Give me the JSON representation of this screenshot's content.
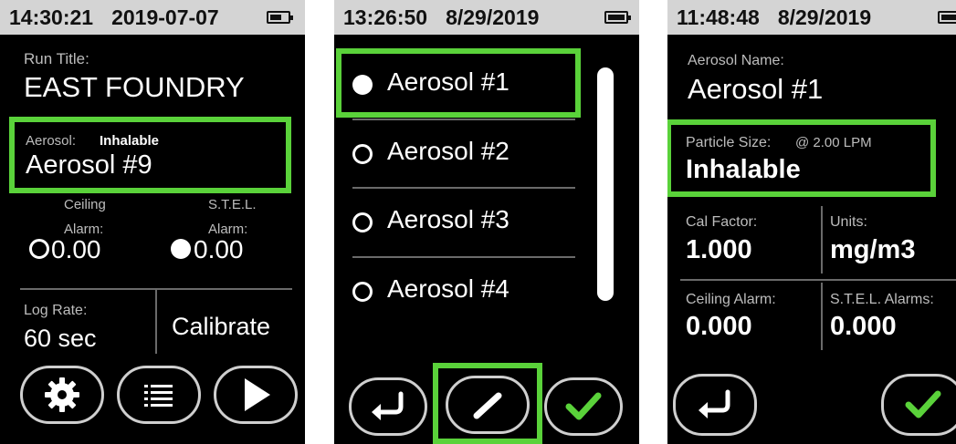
{
  "colors": {
    "highlight": "#5ad23a",
    "screen_bg": "#000000",
    "status_bg": "#d4d4d4",
    "check": "#5ad23a"
  },
  "screen1": {
    "status": {
      "time": "14:30:21",
      "date": "2019-07-07"
    },
    "run_title_label": "Run Title:",
    "run_title_value": "EAST FOUNDRY",
    "aerosol_label": "Aerosol:",
    "aerosol_type": "Inhalable",
    "aerosol_value": "Aerosol #9",
    "ceiling_label": "Ceiling",
    "ceiling_alarm_label": "Alarm:",
    "ceiling_alarm_value": "0.00",
    "stel_label": "S.T.E.L.",
    "stel_alarm_label": "Alarm:",
    "stel_alarm_value": "0.00",
    "log_rate_label": "Log Rate:",
    "log_rate_value": "60 sec",
    "calibrate_label": "Calibrate",
    "icons": [
      "gear-icon",
      "list-icon",
      "play-icon"
    ]
  },
  "screen2": {
    "status": {
      "time": "13:26:50",
      "date": "8/29/2019"
    },
    "items": [
      {
        "label": "Aerosol #1",
        "selected": true
      },
      {
        "label": "Aerosol #2",
        "selected": false
      },
      {
        "label": "Aerosol #3",
        "selected": false
      },
      {
        "label": "Aerosol #4",
        "selected": false
      }
    ],
    "icons": [
      "back-icon",
      "edit-pen-icon",
      "check-icon"
    ]
  },
  "screen3": {
    "status": {
      "time": "11:48:48",
      "date": "8/29/2019"
    },
    "aerosol_name_label": "Aerosol Name:",
    "aerosol_name_value": "Aerosol #1",
    "particle_size_label": "Particle Size:",
    "particle_size_flow": "@ 2.00 LPM",
    "particle_size_value": "Inhalable",
    "cal_factor_label": "Cal Factor:",
    "cal_factor_value": "1.000",
    "units_label": "Units:",
    "units_value": "mg/m3",
    "ceiling_alarm_label": "Ceiling Alarm:",
    "ceiling_alarm_value": "0.000",
    "stel_alarms_label": "S.T.E.L. Alarms:",
    "stel_alarms_value": "0.000",
    "icons": [
      "back-icon",
      "check-icon"
    ]
  }
}
